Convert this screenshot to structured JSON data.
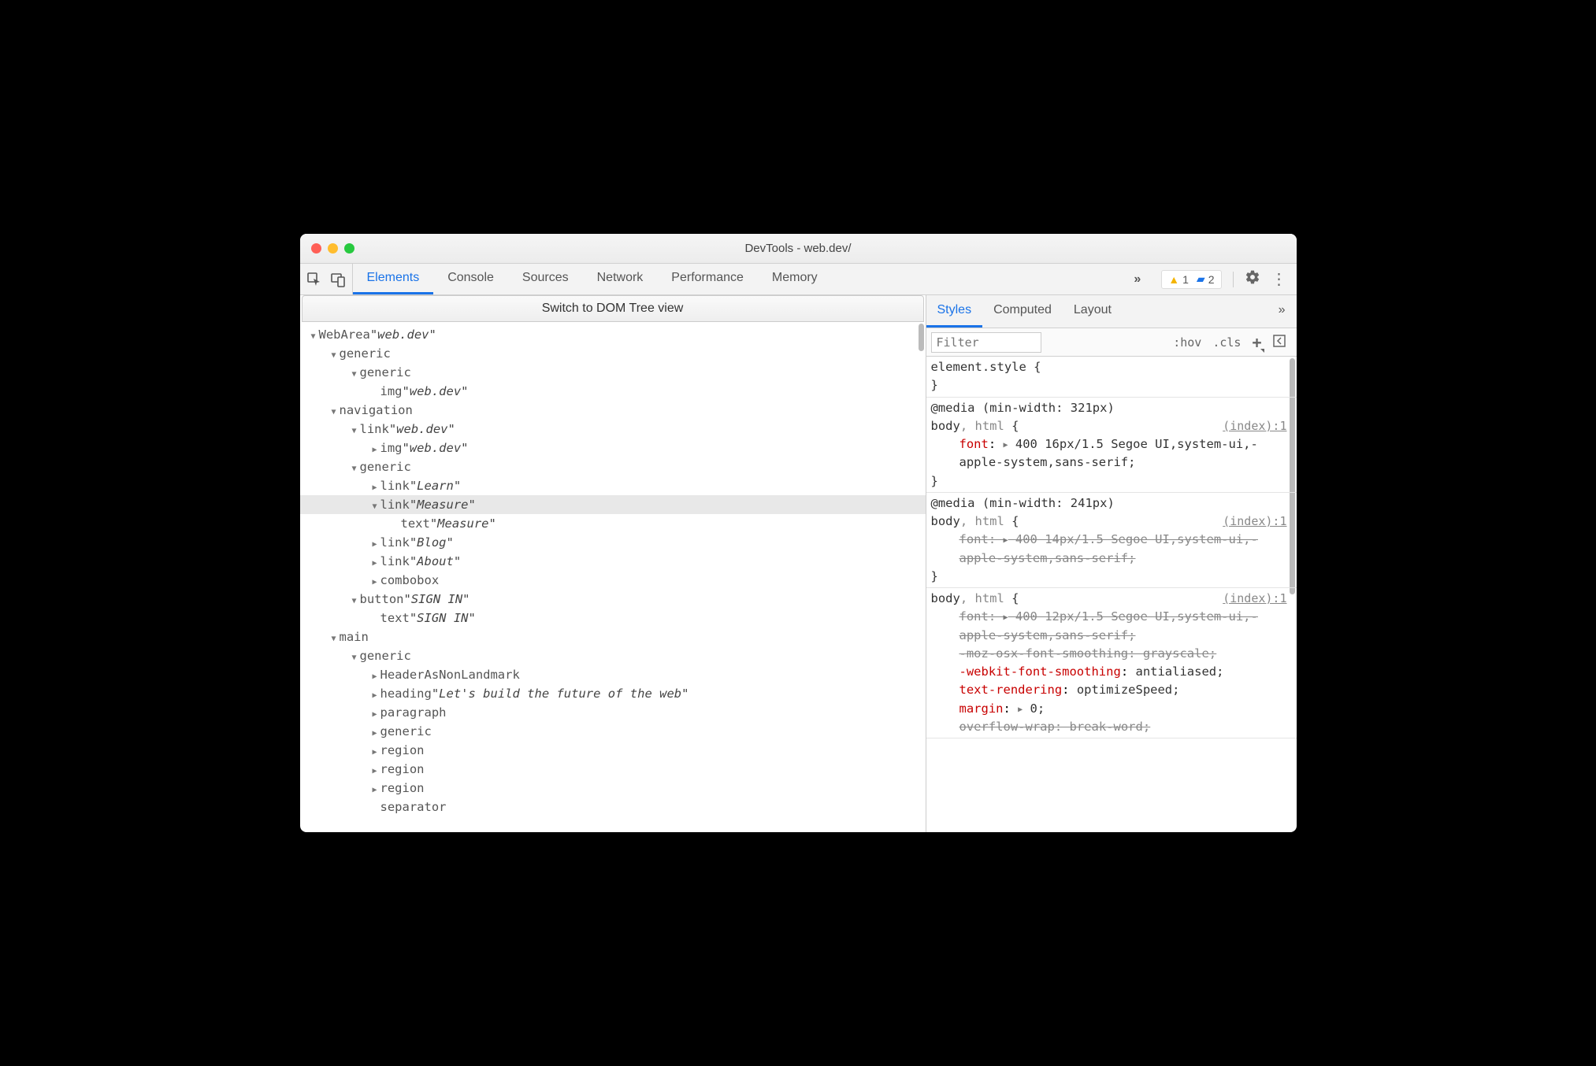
{
  "window": {
    "title": "DevTools - web.dev/"
  },
  "toolbar": {
    "tabs": [
      "Elements",
      "Console",
      "Sources",
      "Network",
      "Performance",
      "Memory"
    ],
    "activeTab": "Elements",
    "overflow": "»",
    "warnings": "1",
    "issues": "2"
  },
  "domSwitch": {
    "label": "Switch to DOM Tree view"
  },
  "tree": {
    "rows": [
      {
        "depth": 0,
        "arrow": "down",
        "role": "WebArea",
        "label": "web.dev",
        "selected": false
      },
      {
        "depth": 1,
        "arrow": "down",
        "role": "generic",
        "label": "",
        "selected": false
      },
      {
        "depth": 2,
        "arrow": "down",
        "role": "generic",
        "label": "",
        "selected": false
      },
      {
        "depth": 3,
        "arrow": "none",
        "role": "img",
        "label": "web.dev",
        "selected": false
      },
      {
        "depth": 1,
        "arrow": "down",
        "role": "navigation",
        "label": "",
        "selected": false
      },
      {
        "depth": 2,
        "arrow": "down",
        "role": "link",
        "label": "web.dev",
        "selected": false
      },
      {
        "depth": 3,
        "arrow": "right",
        "role": "img",
        "label": "web.dev",
        "selected": false
      },
      {
        "depth": 2,
        "arrow": "down",
        "role": "generic",
        "label": "",
        "selected": false
      },
      {
        "depth": 3,
        "arrow": "right",
        "role": "link",
        "label": "Learn",
        "selected": false
      },
      {
        "depth": 3,
        "arrow": "down",
        "role": "link",
        "label": "Measure",
        "selected": true
      },
      {
        "depth": 4,
        "arrow": "none",
        "role": "text",
        "label": "Measure",
        "selected": false
      },
      {
        "depth": 3,
        "arrow": "right",
        "role": "link",
        "label": "Blog",
        "selected": false
      },
      {
        "depth": 3,
        "arrow": "right",
        "role": "link",
        "label": "About",
        "selected": false
      },
      {
        "depth": 3,
        "arrow": "right",
        "role": "combobox",
        "label": "",
        "selected": false
      },
      {
        "depth": 2,
        "arrow": "down",
        "role": "button",
        "label": "SIGN IN",
        "selected": false
      },
      {
        "depth": 3,
        "arrow": "none",
        "role": "text",
        "label": "SIGN IN",
        "selected": false
      },
      {
        "depth": 1,
        "arrow": "down",
        "role": "main",
        "label": "",
        "selected": false
      },
      {
        "depth": 2,
        "arrow": "down",
        "role": "generic",
        "label": "",
        "selected": false
      },
      {
        "depth": 3,
        "arrow": "right",
        "role": "HeaderAsNonLandmark",
        "label": "",
        "selected": false
      },
      {
        "depth": 3,
        "arrow": "right",
        "role": "heading",
        "label": "Let's build the future of the web",
        "selected": false
      },
      {
        "depth": 3,
        "arrow": "right",
        "role": "paragraph",
        "label": "",
        "selected": false
      },
      {
        "depth": 3,
        "arrow": "right",
        "role": "generic",
        "label": "",
        "selected": false
      },
      {
        "depth": 3,
        "arrow": "right",
        "role": "region",
        "label": "",
        "selected": false
      },
      {
        "depth": 3,
        "arrow": "right",
        "role": "region",
        "label": "",
        "selected": false
      },
      {
        "depth": 3,
        "arrow": "right",
        "role": "region",
        "label": "",
        "selected": false
      },
      {
        "depth": 3,
        "arrow": "none",
        "role": "separator",
        "label": "",
        "selected": false
      }
    ]
  },
  "stylesPane": {
    "tabs": [
      "Styles",
      "Computed",
      "Layout"
    ],
    "activeTab": "Styles",
    "overflow": "»",
    "filterPlaceholder": "Filter",
    "tools": {
      "hov": ":hov",
      "cls": ".cls"
    },
    "rules": [
      {
        "media": "",
        "selector": "element.style",
        "dim": "",
        "source": "",
        "decls": []
      },
      {
        "media": "@media (min-width: 321px)",
        "selector": "body",
        "dim": ", html",
        "source": "(index):1",
        "decls": [
          {
            "prop": "font",
            "val": "400 16px/1.5 Segoe UI,system-ui,-apple-system,sans-serif;",
            "struck": false,
            "tri": true
          }
        ]
      },
      {
        "media": "@media (min-width: 241px)",
        "selector": "body",
        "dim": ", html",
        "source": "(index):1",
        "decls": [
          {
            "prop": "font",
            "val": "400 14px/1.5 Segoe UI,system-ui,-apple-system,sans-serif;",
            "struck": true,
            "tri": true
          }
        ]
      },
      {
        "media": "",
        "selector": "body",
        "dim": ", html",
        "source": "(index):1",
        "decls": [
          {
            "prop": "font",
            "val": "400 12px/1.5 Segoe UI,system-ui,-apple-system,sans-serif;",
            "struck": true,
            "tri": true
          },
          {
            "prop": "-moz-osx-font-smoothing",
            "val": "grayscale;",
            "struck": true,
            "tri": false
          },
          {
            "prop": "-webkit-font-smoothing",
            "val": "antialiased;",
            "struck": false,
            "tri": false
          },
          {
            "prop": "text-rendering",
            "val": "optimizeSpeed;",
            "struck": false,
            "tri": false
          },
          {
            "prop": "margin",
            "val": "0;",
            "struck": false,
            "tri": true
          },
          {
            "prop": "overflow-wrap",
            "val": "break-word;",
            "struck": true,
            "tri": false
          }
        ],
        "openEnded": true
      }
    ]
  }
}
